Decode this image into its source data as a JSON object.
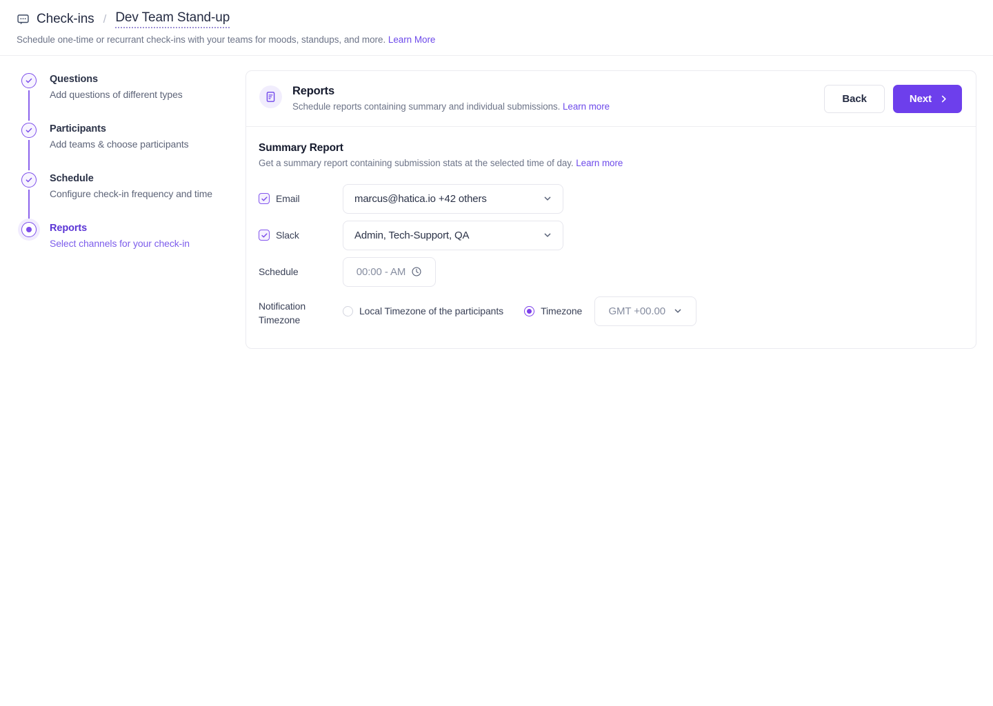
{
  "header": {
    "chat_icon": "chat-bubble-icon",
    "root_crumb": "Check-ins",
    "separator": "/",
    "current_crumb": "Dev Team Stand-up",
    "subtitle": "Schedule one-time or recurrant check-ins with your teams for moods, standups, and more.",
    "subtitle_link": "Learn More"
  },
  "stepper": {
    "steps": [
      {
        "title": "Questions",
        "desc": "Add questions of different types",
        "state": "complete"
      },
      {
        "title": "Participants",
        "desc": "Add teams & choose participants",
        "state": "complete"
      },
      {
        "title": "Schedule",
        "desc": "Configure check-in frequency and time",
        "state": "complete"
      },
      {
        "title": "Reports",
        "desc": "Select channels for your check-in",
        "state": "active"
      }
    ]
  },
  "card": {
    "icon": "report-document-icon",
    "title": "Reports",
    "subtitle": "Schedule reports containing summary and individual submissions.",
    "subtitle_link": "Learn more",
    "back_label": "Back",
    "next_label": "Next",
    "next_icon": "chevron-right-icon"
  },
  "summary": {
    "title": "Summary Report",
    "subtitle": "Get a summary report containing submission stats at the selected time of day.",
    "subtitle_link": "Learn more",
    "email": {
      "label": "Email",
      "checked": true,
      "value": "marcus@hatica.io +42 others"
    },
    "slack": {
      "label": "Slack",
      "checked": true,
      "value": "Admin, Tech-Support, QA"
    },
    "schedule": {
      "label": "Schedule",
      "placeholder": "00:00 - AM",
      "icon": "clock-icon"
    },
    "timezone": {
      "label_line1": "Notification",
      "label_line2": "Timezone",
      "option_local": "Local Timezone of the participants",
      "option_local_selected": false,
      "option_timezone": "Timezone",
      "option_timezone_selected": true,
      "value": "GMT +00.00"
    }
  },
  "colors": {
    "accent": "#6d3fec",
    "accent_light": "#f1edfd",
    "text": "#151a2d",
    "muted": "#6d7488",
    "border": "#e6e6ed"
  }
}
